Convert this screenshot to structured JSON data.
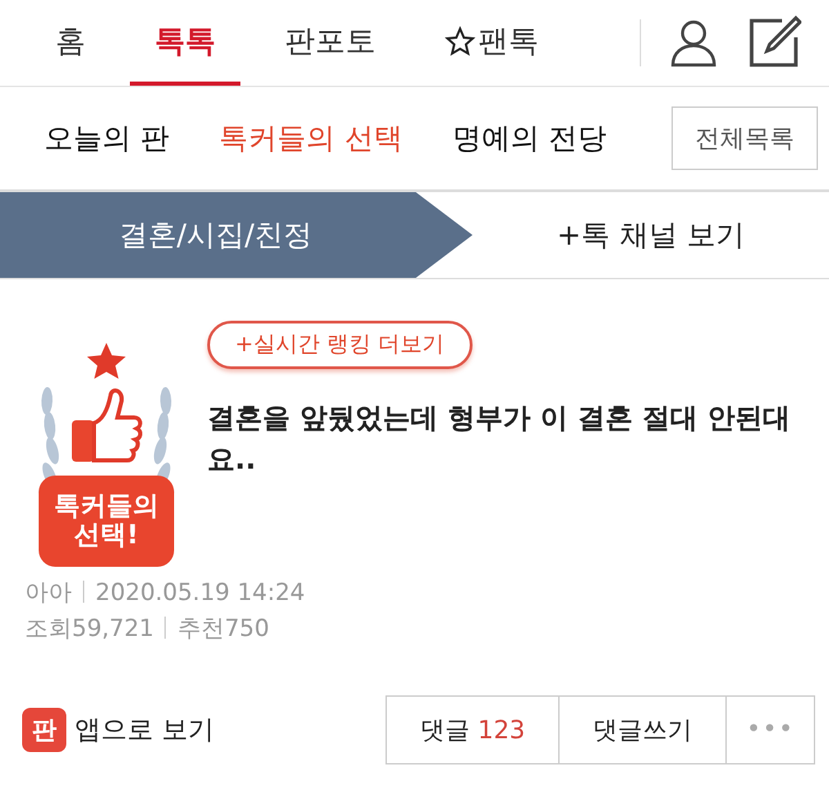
{
  "top_nav": {
    "tabs": [
      {
        "label": "홈",
        "selected": false,
        "kind": "text"
      },
      {
        "label": "톡톡",
        "selected": true,
        "kind": "text"
      },
      {
        "label": "판포토",
        "selected": false,
        "kind": "text"
      },
      {
        "label": "팬톡",
        "selected": false,
        "kind": "star"
      }
    ]
  },
  "sub_nav": {
    "items": [
      {
        "label": "오늘의 판",
        "selected": false
      },
      {
        "label": "톡커들의 선택",
        "selected": true
      },
      {
        "label": "명예의 전당",
        "selected": false
      }
    ],
    "all_button": "전체목록"
  },
  "channel_bar": {
    "current": "결혼/시집/친정",
    "more": "+톡 채널 보기"
  },
  "post": {
    "badge": "톡커들의 선택!",
    "ranking_button": "+실시간 랭킹 더보기",
    "title": "결혼을 앞뒀었는데 형부가 이 결혼 절대 안된대요..",
    "author": "아아",
    "date": "2020.05.19 14:24",
    "views": "조회59,721",
    "recommends": "추천750"
  },
  "footer": {
    "app_icon_text": "판",
    "app_link": "앱으로 보기",
    "comments_label": "댓글",
    "comments_count": "123",
    "write_comment": "댓글쓰기",
    "more": "•••"
  }
}
